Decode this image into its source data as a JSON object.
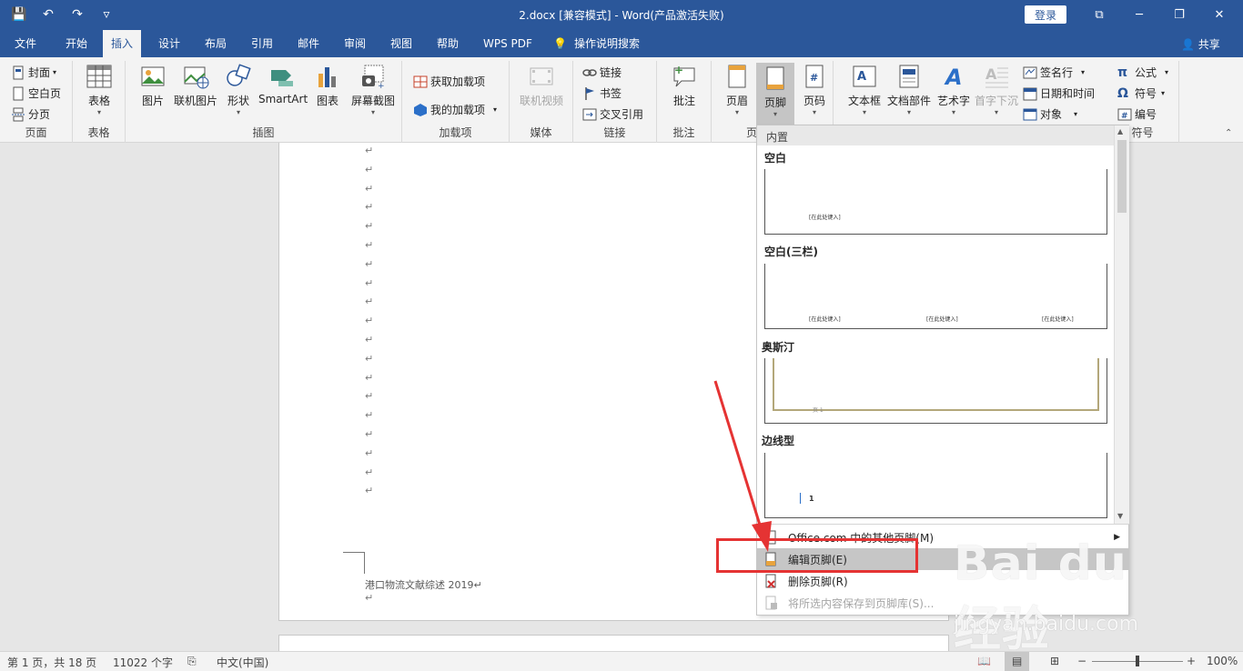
{
  "titlebar": {
    "title": "2.docx [兼容模式] - Word(产品激活失败)",
    "login": "登录",
    "qat": {
      "save": "💾",
      "undo": "↶",
      "redo": "↷",
      "customize": "▿"
    },
    "controls": {
      "ribbon_display": "⧉",
      "minimize": "─",
      "restore": "❐",
      "close": "✕"
    }
  },
  "tabs": [
    "文件",
    "开始",
    "插入",
    "设计",
    "布局",
    "引用",
    "邮件",
    "审阅",
    "视图",
    "帮助",
    "WPS PDF",
    "操作说明搜索"
  ],
  "active_tab": "插入",
  "share": "共享",
  "ribbon": {
    "page_group": {
      "label": "页面",
      "cover": "封面",
      "blank": "空白页",
      "break": "分页"
    },
    "table_group": {
      "label": "表格",
      "table": "表格"
    },
    "illus_group": {
      "label": "插图",
      "picture": "图片",
      "online_picture": "联机图片",
      "shapes": "形状",
      "smartart": "SmartArt",
      "chart": "图表",
      "screenshot": "屏幕截图"
    },
    "addins_group": {
      "label": "加载项",
      "get": "获取加载项",
      "mine": "我的加载项"
    },
    "media_group": {
      "label": "媒体",
      "online_video": "联机视频"
    },
    "links_group": {
      "label": "链接",
      "link": "链接",
      "bookmark": "书签",
      "crossref": "交叉引用"
    },
    "comment_group": {
      "label": "批注",
      "comment": "批注"
    },
    "hf_group": {
      "label": "页",
      "header": "页眉",
      "footer": "页脚",
      "page_number": "页码"
    },
    "text_group": {
      "textbox": "文本框",
      "quickparts": "文档部件",
      "wordart": "艺术字",
      "dropcap": "首字下沉",
      "signature": "签名行",
      "datetime": "日期和时间",
      "object": "对象"
    },
    "symbols_group": {
      "label": "符号",
      "equation": "公式",
      "symbol": "符号",
      "numbering": "编号"
    }
  },
  "document": {
    "para_mark": "↵",
    "footer_text": "港口物流文献综述 2019↵",
    "footer_para": "↵"
  },
  "dropdown": {
    "header": "内置",
    "gallery": [
      {
        "title": "空白",
        "placeholder": "[在此处键入]"
      },
      {
        "title": "空白(三栏)",
        "placeholder": "[在此处键入]"
      },
      {
        "title": "奥斯汀",
        "placeholder": "页 1"
      },
      {
        "title": "边线型",
        "placeholder": "1"
      }
    ],
    "menu": [
      {
        "label": "Office.com 中的其他页脚(M)"
      },
      {
        "label": "编辑页脚(E)"
      },
      {
        "label": "删除页脚(R)"
      },
      {
        "label": "将所选内容保存到页脚库(S)..."
      }
    ]
  },
  "watermark": {
    "logo": "Bai du 经验",
    "url": "jingyan.baidu.com"
  },
  "statusbar": {
    "page": "第 1 页，共 18 页",
    "words": "11022 个字",
    "language": "中文(中国)",
    "zoom": "100%",
    "zoom_minus": "−",
    "zoom_plus": "+"
  },
  "colors": {
    "accent": "#2b579a",
    "annotation": "#e53333"
  }
}
